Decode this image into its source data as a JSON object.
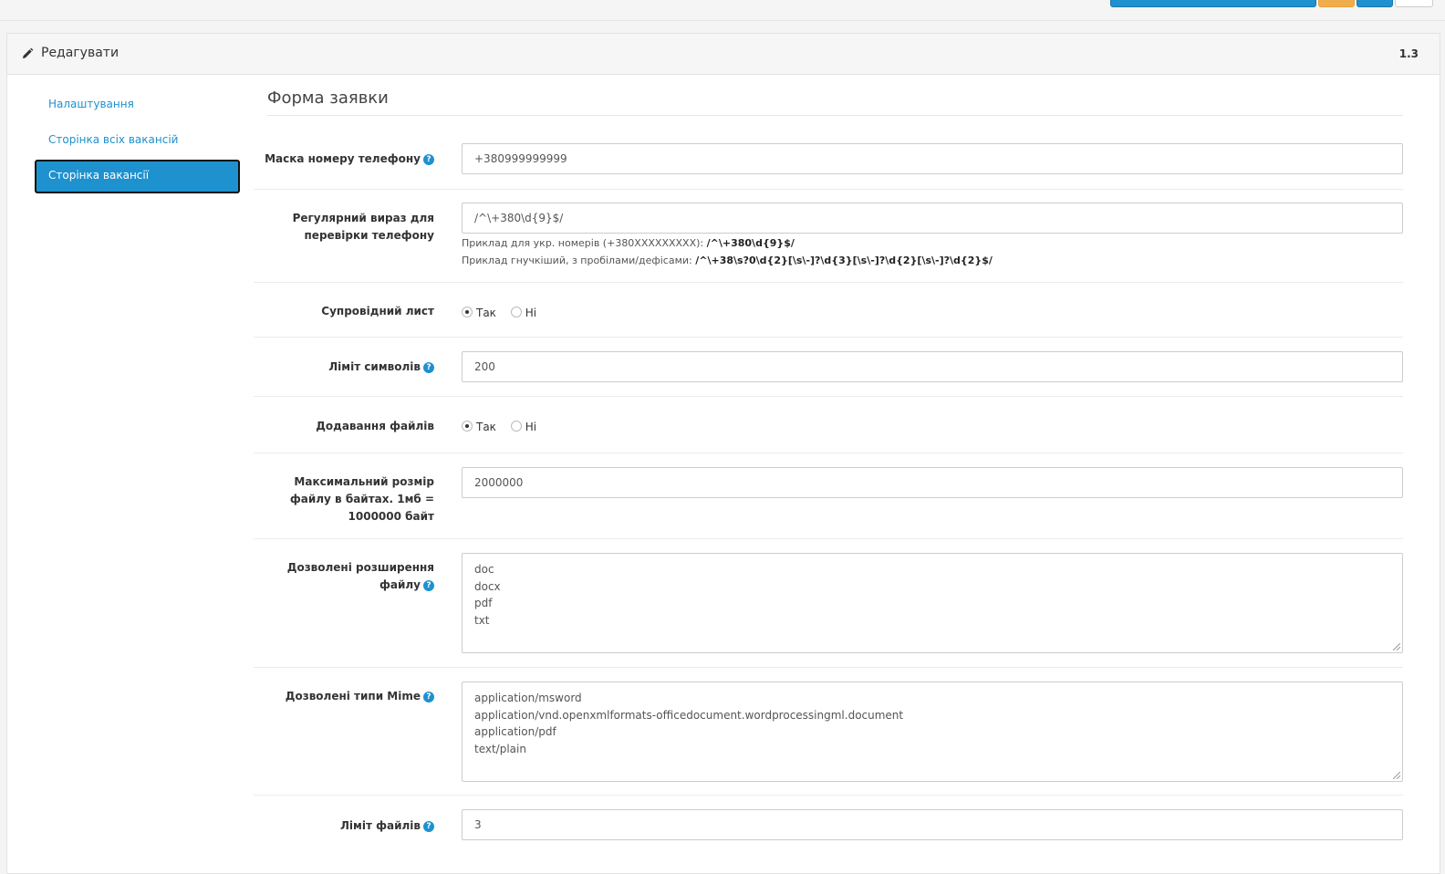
{
  "panel": {
    "title": "Редагувати",
    "version": "1.3"
  },
  "sidebar": {
    "items": [
      {
        "label": "Налаштування",
        "active": false
      },
      {
        "label": "Сторінка всіх вакансій",
        "active": false
      },
      {
        "label": "Сторінка вакансії",
        "active": true
      }
    ]
  },
  "section": {
    "title": "Форма заявки"
  },
  "form": {
    "phone_mask": {
      "label": "Маска номеру телефону",
      "value": "+380999999999"
    },
    "phone_regex": {
      "label": "Регулярний вираз для перевірки телефону",
      "value": "/^\\+380\\d{9}$/",
      "hint1_prefix": "Приклад для укр. номерів (+380XXXXXXXXX): ",
      "hint1_code": "/^\\+380\\d{9}$/",
      "hint2_prefix": "Приклад гнучкіший, з пробілами/дефісами: ",
      "hint2_code": "/^\\+38\\s?0\\d{2}[\\s\\-]?\\d{3}[\\s\\-]?\\d{2}[\\s\\-]?\\d{2}$/"
    },
    "cover_letter": {
      "label": "Супровідний лист",
      "yes": "Так",
      "no": "Ні",
      "selected": "yes"
    },
    "char_limit": {
      "label": "Ліміт символів",
      "value": "200"
    },
    "file_upload": {
      "label": "Додавання файлів",
      "yes": "Так",
      "no": "Ні",
      "selected": "yes"
    },
    "max_size": {
      "label": "Максимальний розмір файлу в байтах. 1мб = 1000000 байт",
      "value": "2000000"
    },
    "extensions": {
      "label": "Дозволені розширення файлу",
      "value": "doc\ndocx\npdf\ntxt"
    },
    "mime": {
      "label": "Дозволені типи Mime",
      "value": "application/msword\napplication/vnd.openxmlformats-officedocument.wordprocessingml.document\napplication/pdf\ntext/plain"
    },
    "file_limit": {
      "label": "Ліміт файлів",
      "value": "3"
    }
  },
  "icons": {
    "help": "?"
  },
  "colors": {
    "primary": "#1e91cf",
    "warning": "#f0ad4e"
  }
}
